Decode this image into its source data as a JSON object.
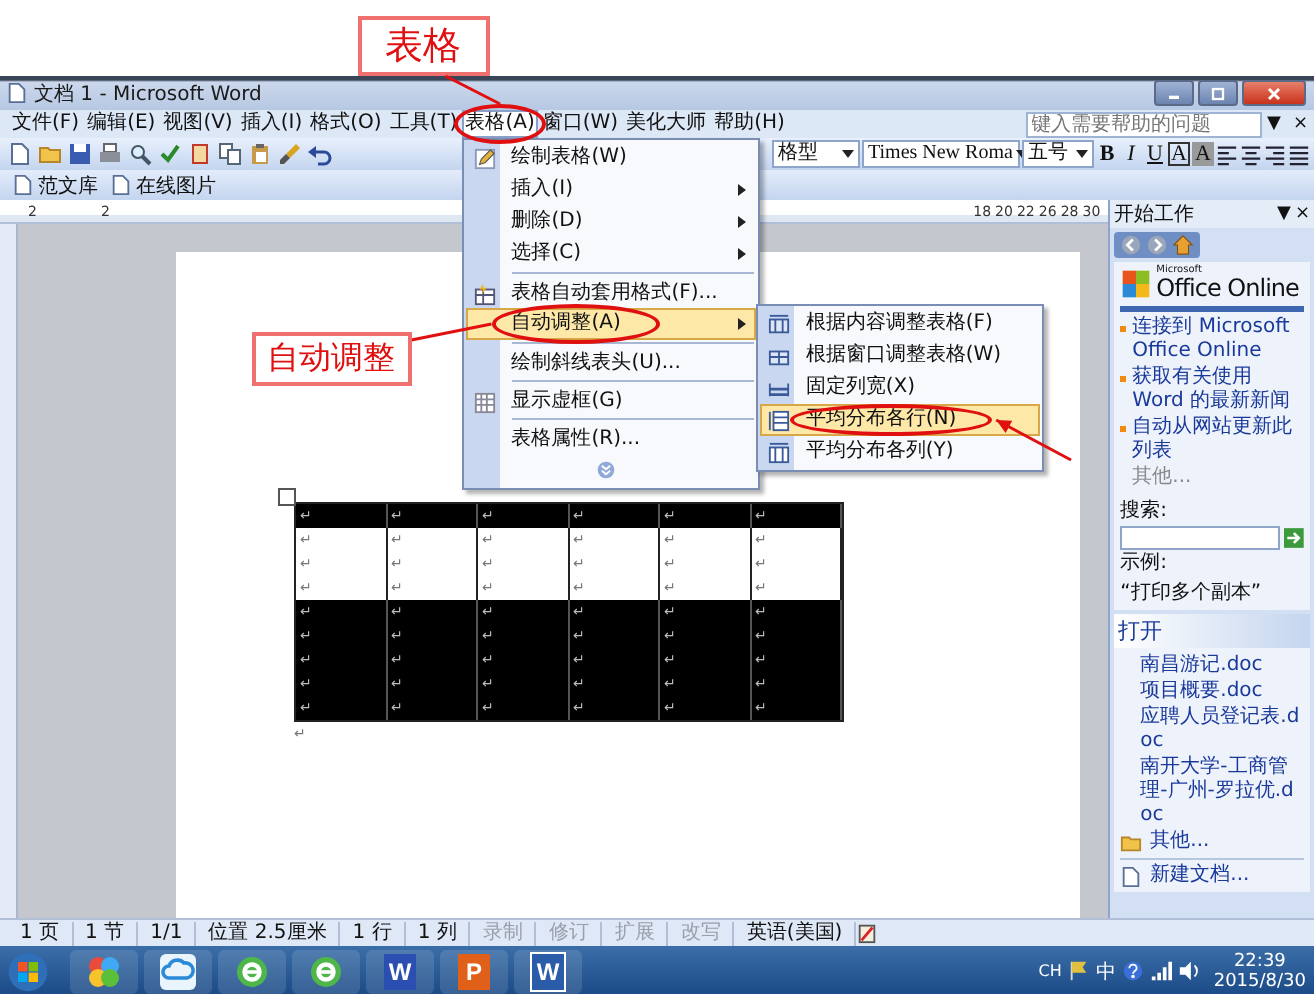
{
  "annotations": {
    "menu_callout": "表格",
    "item_callout": "自动调整"
  },
  "window": {
    "title": "文档 1 - Microsoft Word"
  },
  "menu_bar": {
    "items": [
      {
        "label": "文件(F)",
        "selected": false
      },
      {
        "label": "编辑(E)",
        "selected": false
      },
      {
        "label": "视图(V)",
        "selected": false
      },
      {
        "label": "插入(I)",
        "selected": false
      },
      {
        "label": "格式(O)",
        "selected": false
      },
      {
        "label": "工具(T)",
        "selected": false
      },
      {
        "label": "表格(A)",
        "selected": true
      },
      {
        "label": "窗口(W)",
        "selected": false
      },
      {
        "label": "美化大师",
        "selected": false
      },
      {
        "label": "帮助(H)",
        "selected": false
      }
    ],
    "help_placeholder": "键入需要帮助的问题",
    "controls": [
      "▼",
      "×"
    ]
  },
  "standard_toolbar": [
    {
      "kind": "doc"
    },
    {
      "kind": "folder"
    },
    {
      "kind": "disk"
    },
    {
      "kind": "printer"
    },
    {
      "kind": "magnifier"
    },
    {
      "kind": "check"
    },
    {
      "kind": "book"
    },
    {
      "kind": "copy"
    },
    {
      "kind": "paste"
    },
    {
      "kind": "brush"
    },
    {
      "kind": "undo"
    }
  ],
  "formatting_toolbar": {
    "style": "格型",
    "font": "Times New Roma",
    "size": "五号",
    "buttons": [
      {
        "kind": "bold",
        "label": "B"
      },
      {
        "kind": "italic",
        "label": "I"
      },
      {
        "kind": "underline",
        "label": "U"
      },
      {
        "kind": "boxed",
        "label": "A"
      },
      {
        "kind": "shaded",
        "label": "A"
      }
    ],
    "icons": [
      {
        "kind": "align-left"
      },
      {
        "kind": "align-center"
      },
      {
        "kind": "align-right"
      },
      {
        "kind": "justify"
      }
    ]
  },
  "extra_toolbar": [
    {
      "label": "范文库"
    },
    {
      "label": "在线图片"
    }
  ],
  "ruler": {
    "left_labels": [
      "2",
      "2"
    ],
    "right_labels": [
      "18",
      "20",
      "22",
      "26",
      "28",
      "30"
    ]
  },
  "table_menu": {
    "items": [
      {
        "kind": "command",
        "label": "绘制表格(W)",
        "submenu": false,
        "separator_before": false,
        "selected": false
      },
      {
        "kind": "command",
        "label": "插入(I)",
        "submenu": true,
        "separator_before": false,
        "selected": false
      },
      {
        "kind": "command",
        "label": "删除(D)",
        "submenu": true,
        "separator_before": false,
        "selected": false
      },
      {
        "kind": "command",
        "label": "选择(C)",
        "submenu": true,
        "separator_before": false,
        "selected": false
      },
      {
        "kind": "command",
        "label": "表格自动套用格式(F)...",
        "submenu": false,
        "separator_before": true,
        "selected": false
      },
      {
        "kind": "command",
        "label": "自动调整(A)",
        "submenu": true,
        "separator_before": false,
        "selected": true
      },
      {
        "kind": "command",
        "label": "绘制斜线表头(U)...",
        "submenu": false,
        "separator_before": true,
        "selected": false
      },
      {
        "kind": "command",
        "label": "显示虚框(G)",
        "submenu": false,
        "separator_before": true,
        "selected": false
      },
      {
        "kind": "command",
        "label": "表格属性(R)...",
        "submenu": false,
        "separator_before": true,
        "selected": false
      },
      {
        "kind": "expand"
      }
    ]
  },
  "autofit_submenu": {
    "items": [
      {
        "kind": "fit-content",
        "label": "根据内容调整表格(F)",
        "selected": false
      },
      {
        "kind": "fit-window",
        "label": "根据窗口调整表格(W)",
        "selected": false
      },
      {
        "kind": "fixed",
        "label": "固定列宽(X)",
        "selected": false
      },
      {
        "kind": "dist-rows",
        "label": "平均分布各行(N)",
        "selected": true
      },
      {
        "kind": "dist-cols",
        "label": "平均分布各列(Y)",
        "selected": false
      }
    ]
  },
  "document": {
    "table": {
      "rows": [
        {
          "selected": true,
          "cells": [
            "↵",
            "↵",
            "↵",
            "↵",
            "↵",
            "↵"
          ]
        },
        {
          "selected": false,
          "cells": [
            "↵",
            "↵",
            "↵",
            "↵",
            "↵",
            "↵"
          ]
        },
        {
          "selected": false,
          "cells": [
            "↵",
            "↵",
            "↵",
            "↵",
            "↵",
            "↵"
          ]
        },
        {
          "selected": false,
          "cells": [
            "↵",
            "↵",
            "↵",
            "↵",
            "↵",
            "↵"
          ]
        },
        {
          "selected": true,
          "cells": [
            "↵",
            "↵",
            "↵",
            "↵",
            "↵",
            "↵"
          ]
        },
        {
          "selected": true,
          "cells": [
            "↵",
            "↵",
            "↵",
            "↵",
            "↵",
            "↵"
          ]
        },
        {
          "selected": true,
          "cells": [
            "↵",
            "↵",
            "↵",
            "↵",
            "↵",
            "↵"
          ]
        },
        {
          "selected": true,
          "cells": [
            "↵",
            "↵",
            "↵",
            "↵",
            "↵",
            "↵"
          ]
        },
        {
          "selected": true,
          "cells": [
            "↵",
            "↵",
            "↵",
            "↵",
            "↵",
            "↵"
          ]
        }
      ]
    },
    "paragraph_mark": "↵"
  },
  "task_pane": {
    "title": "开始工作",
    "controls": [
      "▼",
      "×"
    ],
    "brand_small": "Microsoft",
    "brand": "Office Online",
    "links": [
      {
        "text": "连接到 Microsoft Office Online",
        "disabled": false
      },
      {
        "text": "获取有关使用 Word 的最新新闻",
        "disabled": false
      },
      {
        "text": "自动从网站更新此列表",
        "disabled": false
      },
      {
        "text": "其他...",
        "disabled": true
      }
    ],
    "search_label": "搜索:",
    "example_label": "示例:",
    "example_text": "“打印多个副本”",
    "open_title": "打开",
    "files": [
      "南昌游记.doc",
      "项目概要.doc",
      "应聘人员登记表.doc",
      "南开大学-工商管理-广州-罗拉优.doc"
    ],
    "more": "其他...",
    "new_document": "新建文档..."
  },
  "status_bar": {
    "cells": [
      {
        "text": "1 页",
        "disabled": false
      },
      {
        "text": "1 节",
        "disabled": false
      },
      {
        "text": "1/1",
        "disabled": false
      },
      {
        "text": "位置 2.5厘米",
        "disabled": false
      },
      {
        "text": "1 行",
        "disabled": false
      },
      {
        "text": "1 列",
        "disabled": false
      },
      {
        "text": "录制",
        "disabled": true
      },
      {
        "text": "修订",
        "disabled": true
      },
      {
        "text": "扩展",
        "disabled": true
      },
      {
        "text": "改写",
        "disabled": true
      },
      {
        "text": "英语(美国)",
        "disabled": false
      }
    ]
  },
  "taskbar": {
    "apps": [
      {
        "kind": "balls"
      },
      {
        "kind": "cloud"
      },
      {
        "kind": "ie"
      },
      {
        "kind": "ie"
      },
      {
        "kind": "tile",
        "glyph": "W",
        "color": "#2b4fb0"
      },
      {
        "kind": "tile",
        "glyph": "P",
        "color": "#e0601a"
      },
      {
        "kind": "doc",
        "glyph": "W",
        "color": "#2a5caa"
      }
    ],
    "tray": {
      "lang": "CH",
      "ime": "中",
      "time": "22:39",
      "date": "2015/8/30"
    }
  }
}
